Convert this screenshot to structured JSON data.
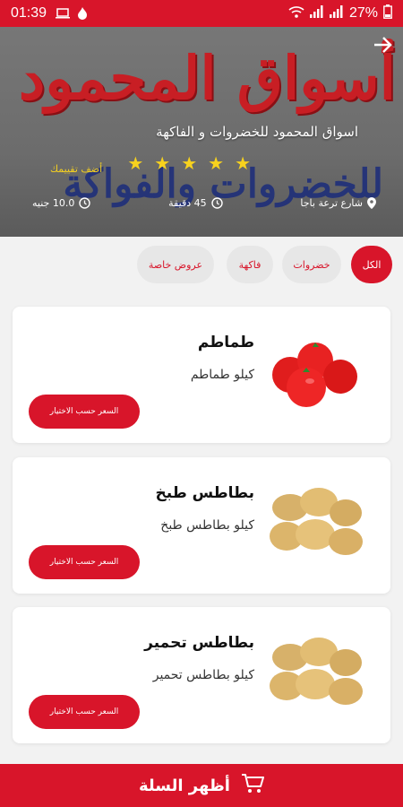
{
  "status_bar": {
    "time": "01:39",
    "battery": "27%"
  },
  "hero": {
    "watermark_top": "أسواق المحمود",
    "watermark_bottom": "للخضروات والفواكة",
    "store_name": "اسواق المحمود للخضروات و الفاكهة",
    "rating_stars": 5,
    "add_rating": "أضف تقييمك",
    "address": "شارع ترعة باجا",
    "time": "45 دقيقة",
    "delivery_fee": "10.0 جنيه"
  },
  "categories": [
    {
      "label": "الكل",
      "active": true
    },
    {
      "label": "خضروات",
      "active": false
    },
    {
      "label": "فاكهة",
      "active": false
    },
    {
      "label": "عروض خاصة",
      "active": false
    }
  ],
  "products": [
    {
      "name": "طماطم",
      "description": "كيلو طماطم",
      "button": "السعر حسب الاختيار",
      "image": "tomatoes"
    },
    {
      "name": "بطاطس طبخ",
      "description": "كيلو بطاطس طبخ",
      "button": "السعر حسب الاختيار",
      "image": "potatoes"
    },
    {
      "name": "بطاطس تحمير",
      "description": "كيلو بطاطس تحمير",
      "button": "السعر حسب الاختيار",
      "image": "potatoes"
    }
  ],
  "bottom_bar": {
    "label": "أظهر السلة",
    "icon": "cart-icon"
  },
  "colors": {
    "accent": "#d8152a",
    "star": "#f7d21e"
  }
}
